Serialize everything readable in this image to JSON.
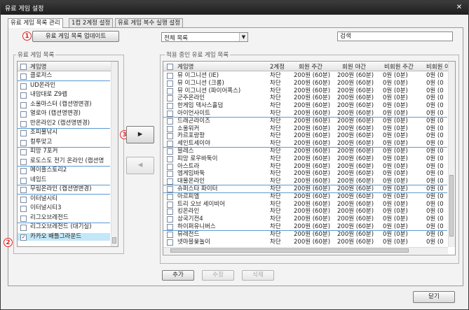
{
  "window": {
    "title": "유료 게임 설정",
    "close": "✕"
  },
  "tabs": [
    "유료 게임 목록 관리",
    "1컴 2계정 설정",
    "유료 게임 복수 실행 설정"
  ],
  "markers": [
    "1",
    "2",
    "3"
  ],
  "update_button": "유료 게임 목록 업데이트",
  "filter": {
    "selected": "전체 목록"
  },
  "search": {
    "value": "검색"
  },
  "left": {
    "group_label": "유료 게임 목록",
    "header": "게임명",
    "items": [
      "클로저스",
      "UD온라인",
      "내맘대로 Z9렙",
      "소울마스터 (캡션명변경)",
      "열로아 (캡션명변경)",
      "반온라인2 (캡션명변경)",
      "조피물낚시",
      "컬투맞고",
      "피망 7포커",
      "로도스도 전기 온라인 (캡션명",
      "메이플스토리2",
      "네임드",
      "무림온라인 (캡션명변경)",
      "이터널시티",
      "이터널시티3",
      "리그오브레전드",
      "리그오브레전드 (대기실)",
      "카카오 배틀그라운드"
    ]
  },
  "right": {
    "group_label": "적용 중인 유료 게임 목록",
    "columns": [
      "게임명",
      "2계정",
      "회원 주간",
      "회원 야간",
      "비회원 주간",
      "비회원 야"
    ],
    "rows": [
      [
        "뮤 이그니션 (IE)",
        "차단",
        "200원 (60분)",
        "200원 (60분)",
        "0원 (0분)",
        "0원 (0"
      ],
      [
        "뮤 이그니션 (크롬)",
        "차단",
        "200원 (60분)",
        "200원 (60분)",
        "0원 (0분)",
        "0원 (0"
      ],
      [
        "뮤 이그니션 (파이어폭스)",
        "차단",
        "200원 (60분)",
        "200원 (60분)",
        "0원 (0분)",
        "0원 (0"
      ],
      [
        "군주온라인",
        "차단",
        "200원 (60분)",
        "200원 (60분)",
        "0원 (0분)",
        "0원 (0"
      ],
      [
        "한게임 덱사스홀덤",
        "차단",
        "200원 (60분)",
        "200원 (60분)",
        "0원 (0분)",
        "0원 (0"
      ],
      [
        "아이언사이트",
        "차단",
        "200원 (60분)",
        "200원 (60분)",
        "0원 (0분)",
        "0원 (0"
      ],
      [
        "드래곤라이즈",
        "차단",
        "200원 (60분)",
        "200원 (60분)",
        "0원 (0분)",
        "0원 (0"
      ],
      [
        "소울워커",
        "차단",
        "200원 (60분)",
        "200원 (60분)",
        "0원 (0분)",
        "0원 (0"
      ],
      [
        "카르포랑팡",
        "차단",
        "200원 (60분)",
        "200원 (60분)",
        "0원 (0분)",
        "0원 (0"
      ],
      [
        "세인트세이야",
        "차단",
        "200원 (60분)",
        "200원 (60분)",
        "0원 (0분)",
        "0원 (0"
      ],
      [
        "블레스",
        "차단",
        "200원 (60분)",
        "200원 (60분)",
        "0원 (0분)",
        "0원 (0"
      ],
      [
        "피망 로우바둑이",
        "차단",
        "200원 (60분)",
        "200원 (60분)",
        "0원 (0분)",
        "0원 (0"
      ],
      [
        "아스트라",
        "차단",
        "200원 (60분)",
        "200원 (60분)",
        "0원 (0분)",
        "0원 (0"
      ],
      [
        "엠게임바둑",
        "차단",
        "200원 (60분)",
        "200원 (60분)",
        "0원 (0분)",
        "0원 (0"
      ],
      [
        "대물온라인",
        "차단",
        "200원 (60분)",
        "200원 (60분)",
        "0원 (0분)",
        "0원 (0"
      ],
      [
        "슈퍼스타 파이터",
        "차단",
        "200원 (60분)",
        "200원 (60분)",
        "0원 (0분)",
        "0원 (0"
      ],
      [
        "아르피엘",
        "차단",
        "200원 (60분)",
        "200원 (60분)",
        "0원 (0분)",
        "0원 (0"
      ],
      [
        "트리 오브 세이비어",
        "차단",
        "200원 (60분)",
        "200원 (60분)",
        "0원 (0분)",
        "0원 (0"
      ],
      [
        "킹온라인",
        "차단",
        "200원 (60분)",
        "200원 (60분)",
        "0원 (0분)",
        "0원 (0"
      ],
      [
        "삼국기전4",
        "차단",
        "200원 (60분)",
        "200원 (60분)",
        "0원 (0분)",
        "0원 (0"
      ],
      [
        "하이퍼유니버스",
        "차단",
        "200원 (60분)",
        "200원 (60분)",
        "0원 (0분)",
        "0원 (0"
      ],
      [
        "뮤레전드",
        "차단",
        "200원 (60분)",
        "200원 (60분)",
        "0원 (0분)",
        "0원 (0"
      ],
      [
        "넷마블윷놀이",
        "차단",
        "200원 (60분)",
        "200원 (60분)",
        "0원 (0분)",
        "0원 (0"
      ]
    ]
  },
  "buttons": {
    "move_right": "▶",
    "move_left": "◀",
    "add": "추가",
    "edit": "수정",
    "delete": "삭제",
    "close": "닫기"
  }
}
